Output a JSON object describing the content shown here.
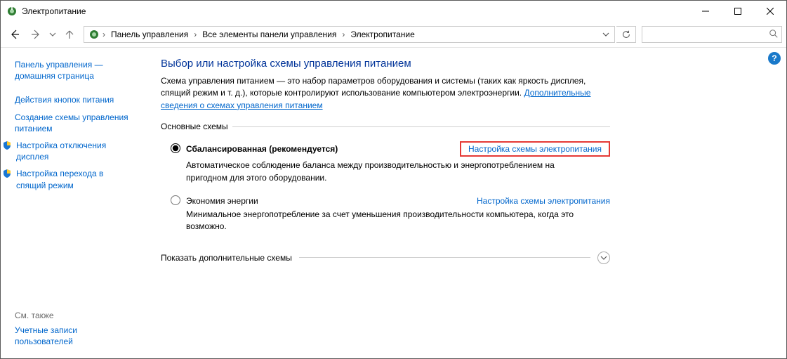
{
  "window": {
    "title": "Электропитание"
  },
  "breadcrumb": {
    "segments": [
      "Панель управления",
      "Все элементы панели управления",
      "Электропитание"
    ]
  },
  "search": {
    "placeholder": ""
  },
  "sidebar": {
    "home": "Панель управления — домашняя страница",
    "links": [
      "Действия кнопок питания",
      "Создание схемы управления питанием"
    ],
    "icon_links": [
      "Настройка отключения дисплея",
      "Настройка перехода в спящий режим"
    ],
    "see_also_label": "См. также",
    "see_also_links": [
      "Учетные записи пользователей"
    ]
  },
  "main": {
    "title": "Выбор или настройка схемы управления питанием",
    "description": "Схема управления питанием — это набор параметров оборудования и системы (таких как яркость дисплея, спящий режим и т. д.), которые контролируют использование компьютером электроэнергии.",
    "learn_more": "Дополнительные сведения о схемах управления питанием",
    "group_label": "Основные схемы",
    "plans": [
      {
        "name": "Сбалансированная (рекомендуется)",
        "link": "Настройка схемы электропитания",
        "desc": "Автоматическое соблюдение баланса между производительностью и энергопотреблением на пригодном для этого оборудовании.",
        "selected": true,
        "highlight": true
      },
      {
        "name": "Экономия энергии",
        "link": "Настройка схемы электропитания",
        "desc": "Минимальное энергопотребление за счет уменьшения производительности компьютера, когда это возможно.",
        "selected": false,
        "highlight": false
      }
    ],
    "expander_label": "Показать дополнительные схемы"
  }
}
